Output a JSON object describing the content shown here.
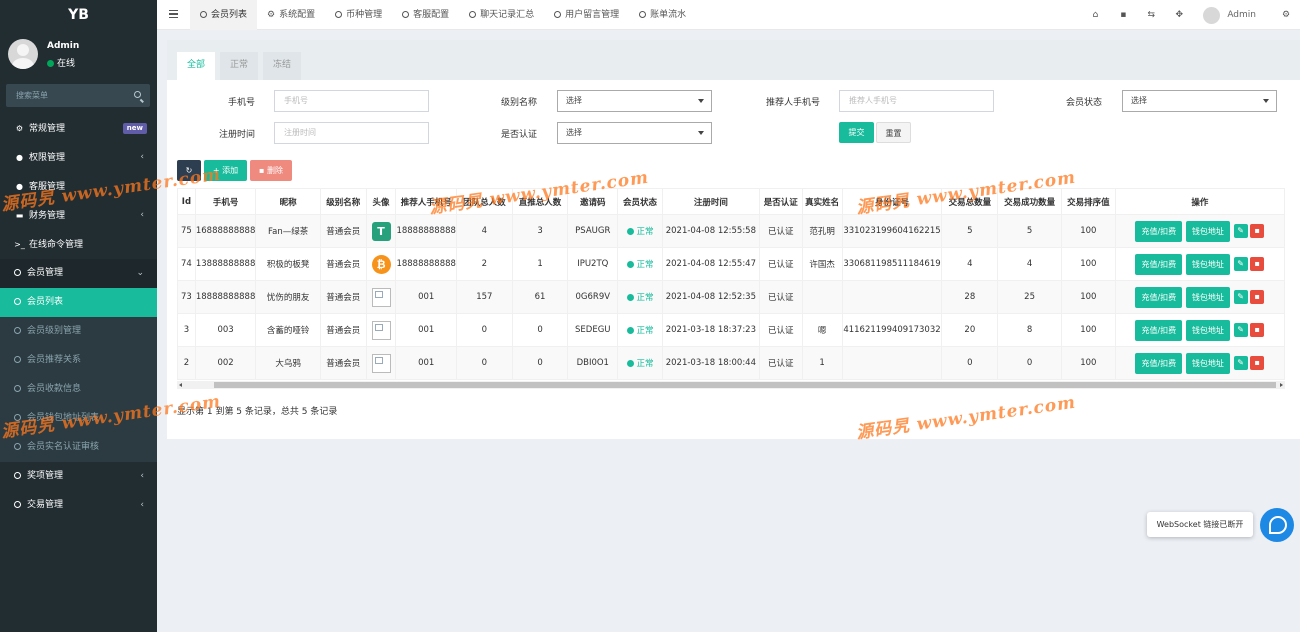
{
  "sidebar": {
    "logo": "YB",
    "user_name": "Admin",
    "user_status": "在线",
    "search_placeholder": "搜索菜单",
    "items": [
      {
        "label": "常规管理",
        "icon": "cogs-icon",
        "badge": "new"
      },
      {
        "label": "权限管理",
        "icon": "users-icon"
      },
      {
        "label": "客服管理",
        "icon": "comment-icon"
      },
      {
        "label": "财务管理",
        "icon": "money-icon"
      },
      {
        "label": "在线命令管理",
        "icon": "terminal-icon"
      },
      {
        "label": "会员管理",
        "icon": "circle-icon"
      },
      {
        "label": "会员列表",
        "icon": "circle-icon"
      },
      {
        "label": "会员级别管理",
        "icon": "circle-icon"
      },
      {
        "label": "会员推荐关系",
        "icon": "circle-icon"
      },
      {
        "label": "会员收款信息",
        "icon": "circle-icon"
      },
      {
        "label": "会员钱包地址列表",
        "icon": "circle-icon"
      },
      {
        "label": "会员实名认证审核",
        "icon": "circle-icon"
      },
      {
        "label": "奖项管理",
        "icon": "circle-icon"
      },
      {
        "label": "交易管理",
        "icon": "circle-icon"
      }
    ]
  },
  "topnav": {
    "tabs": [
      "会员列表",
      "系统配置",
      "币种管理",
      "客服配置",
      "聊天记录汇总",
      "用户留言管理",
      "账单流水"
    ],
    "user": "Admin"
  },
  "panel": {
    "tabs": [
      "全部",
      "正常",
      "冻结"
    ],
    "form": {
      "phone_label": "手机号",
      "phone_placeholder": "手机号",
      "level_label": "级别名称",
      "level_value": "选择",
      "ref_phone_label": "推荐人手机号",
      "ref_phone_placeholder": "推荐人手机号",
      "status_label": "会员状态",
      "status_value": "选择",
      "reg_time_label": "注册时间",
      "reg_time_placeholder": "注册时间",
      "verified_label": "是否认证",
      "verified_value": "选择",
      "submit": "提交",
      "reset": "重置"
    },
    "toolbar": {
      "add": "添加",
      "delete": "删除"
    },
    "table": {
      "headers": [
        "Id",
        "手机号",
        "昵称",
        "级别名称",
        "头像",
        "推荐人手机号",
        "团队总人数",
        "直推总人数",
        "邀请码",
        "会员状态",
        "注册时间",
        "是否认证",
        "真实姓名",
        "身份证号",
        "交易总数量",
        "交易成功数量",
        "交易排序值",
        "操作"
      ],
      "rows": [
        {
          "id": "75",
          "phone": "16888888888",
          "nick": "Fan—绿茶",
          "level": "普通会员",
          "avatar": "tether",
          "ref": "18888888888",
          "team": "4",
          "direct": "3",
          "code": "PSAUGR",
          "status": "正常",
          "reg": "2021-04-08 12:55:58",
          "verified": "已认证",
          "name": "范孔明",
          "idno": "331023199604162215",
          "total": "5",
          "success": "5",
          "sort": "100"
        },
        {
          "id": "74",
          "phone": "13888888888",
          "nick": "积极的板凳",
          "level": "普通会员",
          "avatar": "btc",
          "ref": "18888888888",
          "team": "2",
          "direct": "1",
          "code": "IPU2TQ",
          "status": "正常",
          "reg": "2021-04-08 12:55:47",
          "verified": "已认证",
          "name": "许国杰",
          "idno": "330681198511184619",
          "total": "4",
          "success": "4",
          "sort": "100"
        },
        {
          "id": "73",
          "phone": "18888888888",
          "nick": "忧伤的朋友",
          "level": "普通会员",
          "avatar": "broken",
          "ref": "001",
          "team": "157",
          "direct": "61",
          "code": "0G6R9V",
          "status": "正常",
          "reg": "2021-04-08 12:52:35",
          "verified": "已认证",
          "name": "",
          "idno": "",
          "total": "28",
          "success": "25",
          "sort": "100"
        },
        {
          "id": "3",
          "phone": "003",
          "nick": "含蓄的哑铃",
          "level": "普通会员",
          "avatar": "broken",
          "ref": "001",
          "team": "0",
          "direct": "0",
          "code": "SEDEGU",
          "status": "正常",
          "reg": "2021-03-18 18:37:23",
          "verified": "已认证",
          "name": "嗯",
          "idno": "411621199409173032",
          "total": "20",
          "success": "8",
          "sort": "100"
        },
        {
          "id": "2",
          "phone": "002",
          "nick": "大乌鸦",
          "level": "普通会员",
          "avatar": "broken",
          "ref": "001",
          "team": "0",
          "direct": "0",
          "code": "DBI0O1",
          "status": "正常",
          "reg": "2021-03-18 18:00:44",
          "verified": "已认证",
          "name": "1",
          "idno": "",
          "total": "0",
          "success": "0",
          "sort": "100"
        }
      ],
      "action_recharge": "充值/扣费",
      "action_wallet": "钱包地址"
    },
    "pager": "显示第 1 到第 5 条记录，总共 5 条记录"
  },
  "websocket": "WebSocket 链接已断开",
  "watermark": "源码旯 www.ymter.com",
  "colors": {
    "accent": "#18bc9c",
    "sidebar": "#222d32",
    "danger": "#e74c3c"
  }
}
